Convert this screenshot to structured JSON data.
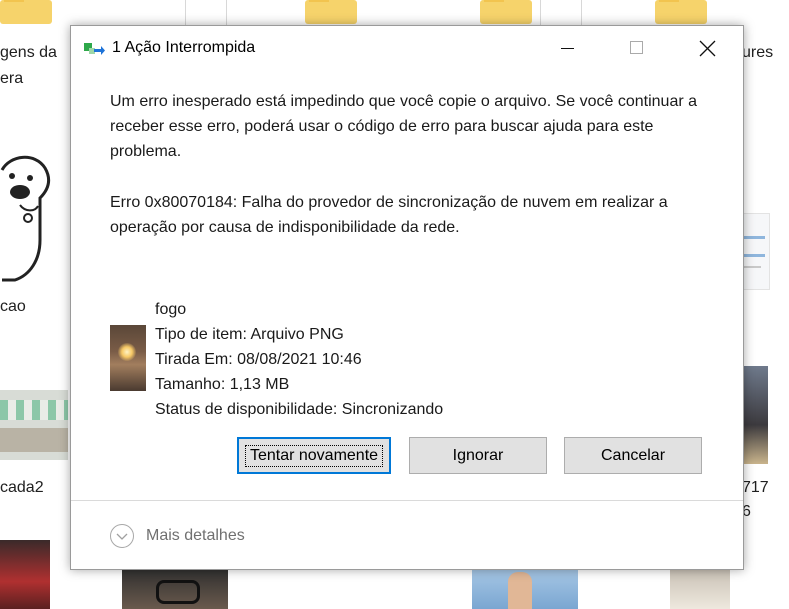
{
  "background": {
    "labels": [
      "gens da",
      "era",
      "cao",
      "cada2",
      "ures",
      "717",
      "6"
    ]
  },
  "dialog": {
    "title": "1 Ação Interrompida",
    "message": "Um erro inesperado está impedindo que você copie o arquivo. Se você continuar a receber esse erro, poderá usar o código de erro para buscar ajuda para este problema.",
    "error": "Erro 0x80070184: Falha do provedor de sincronização de nuvem em realizar a operação por causa de indisponibilidade da rede.",
    "file": {
      "name": "fogo",
      "type": "Tipo de item: Arquivo PNG",
      "taken": "Tirada Em: 08/08/2021 10:46",
      "size": "Tamanho: 1,13 MB",
      "status": "Status de disponibilidade: Sincronizando"
    },
    "buttons": {
      "retry": "Tentar novamente",
      "ignore": "Ignorar",
      "cancel": "Cancelar"
    },
    "more_details": "Mais detalhes"
  }
}
